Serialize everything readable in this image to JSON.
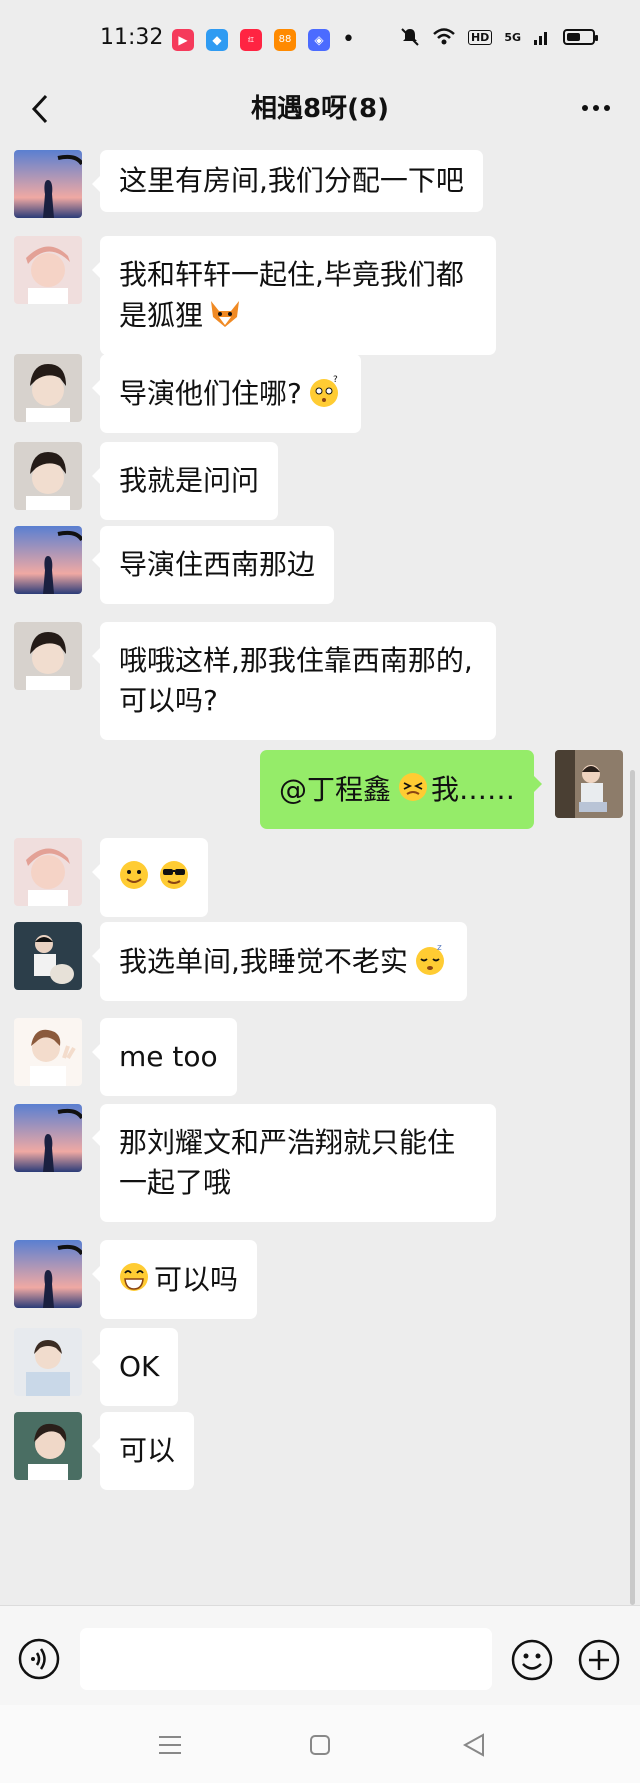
{
  "status_bar": {
    "time": "11:32",
    "app_icons": [
      {
        "name": "video-app-icon",
        "color": "#f53a5b",
        "glyph": "▶"
      },
      {
        "name": "bird-app-icon",
        "color": "#2f9bf2",
        "glyph": "◆"
      },
      {
        "name": "xiaohongshu-app-icon",
        "color": "#ff2442",
        "glyph": "小红书"
      },
      {
        "name": "game-app-icon",
        "color": "#ff8a00",
        "glyph": "88"
      },
      {
        "name": "shape-app-icon",
        "color": "#4b6bff",
        "glyph": "◈"
      }
    ],
    "notification_dot": "•",
    "hd_label": "HD",
    "network_label": "5G",
    "battery_level": 0.55
  },
  "header": {
    "title": "相遇8呀(8)"
  },
  "colors": {
    "background": "#ededed",
    "bubble_other": "#ffffff",
    "bubble_mine": "#95ec69"
  },
  "messages": [
    {
      "sender": "other",
      "avatar": "sunset-silhouette-avatar",
      "text": "这里有房间,我们分配一下吧",
      "emoji": []
    },
    {
      "sender": "other",
      "avatar": "pink-hair-boy-avatar",
      "text": "我和轩轩一起住,毕竟我们都是狐狸",
      "emoji": [
        "fox"
      ]
    },
    {
      "sender": "other",
      "avatar": "dark-hair-boy-avatar",
      "text": "导演他们住哪?",
      "emoji": [
        "thinking-face"
      ]
    },
    {
      "sender": "other",
      "avatar": "dark-hair-boy-avatar",
      "text": "我就是问问",
      "emoji": []
    },
    {
      "sender": "other",
      "avatar": "sunset-silhouette-avatar",
      "text": "导演住西南那边",
      "emoji": []
    },
    {
      "sender": "other",
      "avatar": "dark-hair-boy-avatar",
      "text": "哦哦这样,那我住靠西南那的,可以吗?",
      "emoji": []
    },
    {
      "sender": "me",
      "avatar": "sitting-boy-avatar",
      "text": "@丁程鑫",
      "text_after": "我……",
      "emoji": [
        "tongue-face"
      ]
    },
    {
      "sender": "other",
      "avatar": "pink-hair-boy-avatar",
      "text": "",
      "emoji": [
        "smile-face",
        "sunglasses-face"
      ]
    },
    {
      "sender": "other",
      "avatar": "boy-with-dog-avatar",
      "text": "我选单间,我睡觉不老实",
      "emoji": [
        "sleeping-face"
      ]
    },
    {
      "sender": "other",
      "avatar": "boy-peace-sign-avatar",
      "text": "me too",
      "emoji": []
    },
    {
      "sender": "other",
      "avatar": "sunset-silhouette-avatar",
      "text": "那刘耀文和严浩翔就只能住一起了哦",
      "emoji": []
    },
    {
      "sender": "other",
      "avatar": "sunset-silhouette-avatar",
      "text": "可以吗",
      "emoji_before": [
        "grin-face"
      ],
      "emoji": []
    },
    {
      "sender": "other",
      "avatar": "light-shirt-boy-avatar",
      "text": "OK",
      "emoji": []
    },
    {
      "sender": "other",
      "avatar": "side-profile-boy-avatar",
      "text": "可以",
      "emoji": []
    }
  ],
  "input": {
    "placeholder": ""
  }
}
